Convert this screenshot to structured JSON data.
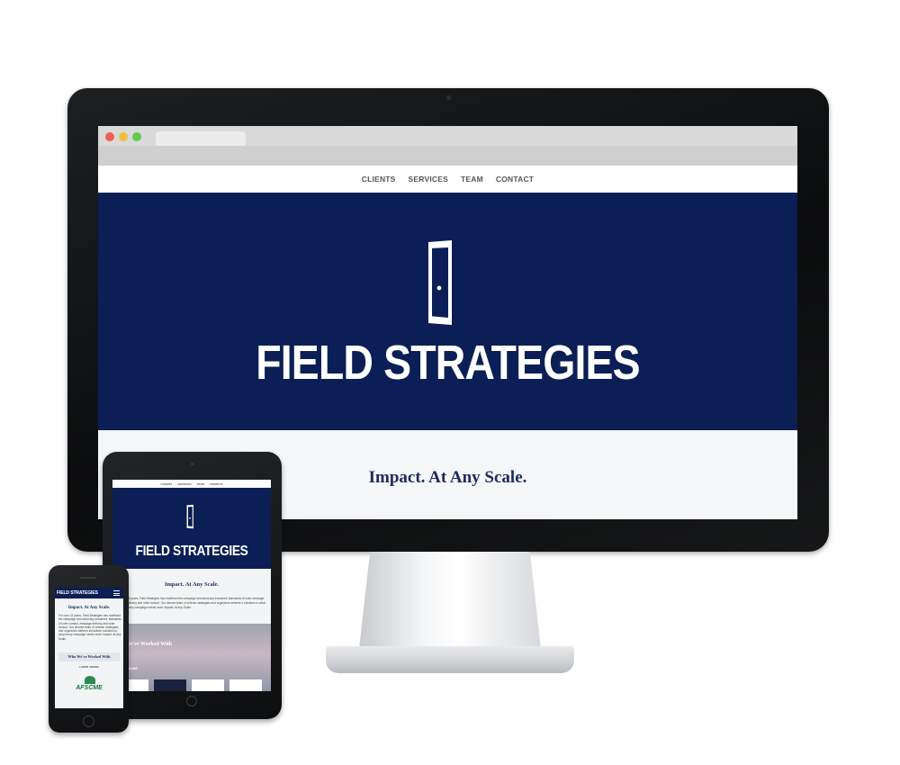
{
  "site": {
    "brand": "FIELD STRATEGIES",
    "tagline": "Impact. At Any Scale.",
    "colors": {
      "navy": "#0b1f56",
      "tagline": "#1b2b5e",
      "nav_text": "#55565a"
    }
  },
  "nav": {
    "items": [
      {
        "label": "CLIENTS"
      },
      {
        "label": "SERVICES"
      },
      {
        "label": "TEAM"
      },
      {
        "label": "CONTACT"
      }
    ]
  },
  "tablet": {
    "body_text": "15 years, Field Strategies has redefined the campaign and advocacy industries' standards of voter message delivery and voter turnout. Our diverse team of veteran strategists and organizers delivers e solutions to what every campaign needs most: Impact. At Any Scale.",
    "worked_with": "We've Worked With",
    "unions": "UNIONS"
  },
  "phone": {
    "body_text": "For over 15 years, Field Strategies has redefined the campaign and advocacy industries' standards of voter contact, message delivery and voter turnout. Our diverse team of veteran strategists and organizers delivers innovative solutions to what every campaign needs most: Impact. At Any Scale.",
    "worked_with": "Who We've Worked With",
    "labor_unions": "LABOR UNIONS",
    "logo_text": "AFSCME"
  }
}
